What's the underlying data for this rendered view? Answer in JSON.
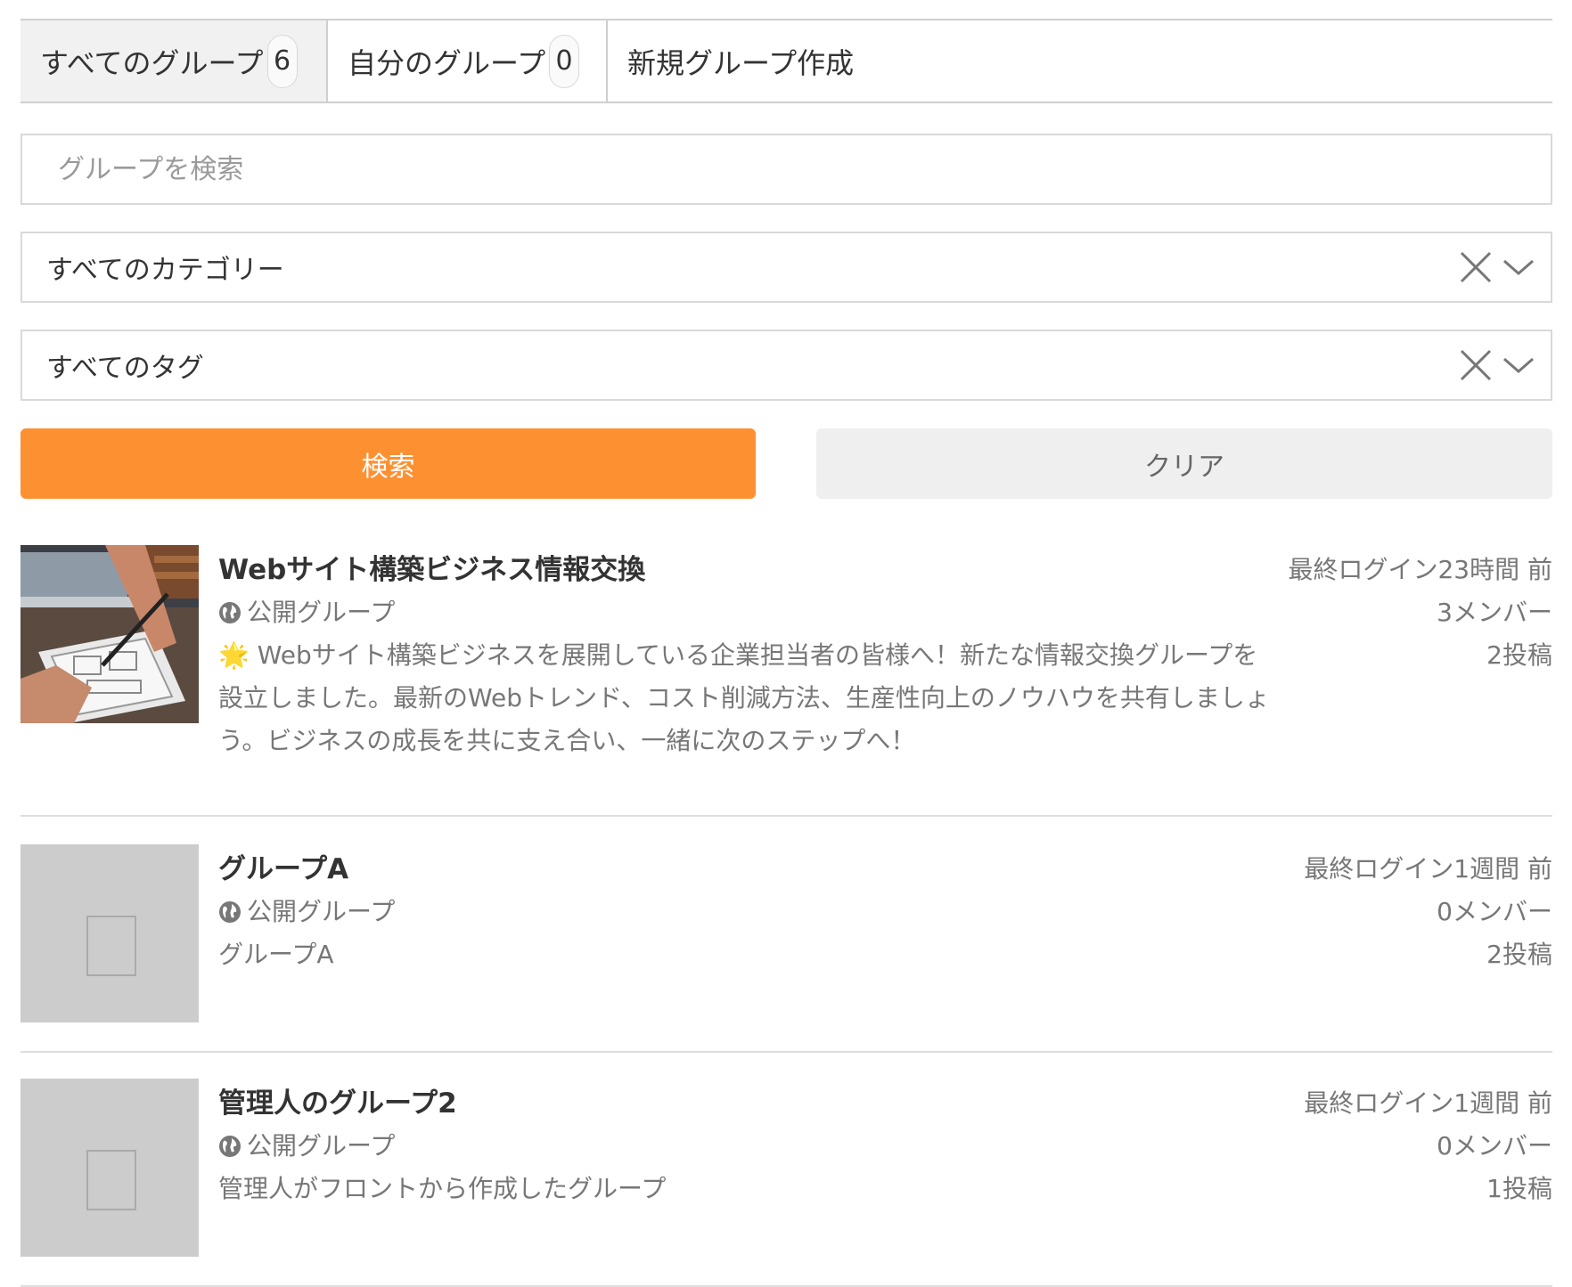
{
  "tabs": [
    {
      "label": "すべてのグループ",
      "count": "6"
    },
    {
      "label": "自分のグループ",
      "count": "0"
    },
    {
      "label": "新規グループ作成"
    }
  ],
  "search": {
    "placeholder": "グループを検索",
    "value": ""
  },
  "filters": {
    "category": {
      "selected": "すべてのカテゴリー"
    },
    "tag": {
      "selected": "すべてのタグ"
    }
  },
  "buttons": {
    "search_label": "検索",
    "clear_label": "クリア"
  },
  "colors": {
    "accent": "#fd9132",
    "clear_button": "#efefef",
    "placeholder_thumb": "#cccccc"
  },
  "groups": [
    {
      "name": "Webサイト構築ビジネス情報交換",
      "type": "公開グループ",
      "description": "🌟 Webサイト構築ビジネスを展開している企業担当者の皆様へ！新たな情報交換グループを設立しました。最新のWebトレンド、コスト削減方法、生産性向上のノウハウを共有しましょう。ビジネスの成長を共に支え合い、一緒に次のステップへ！",
      "last_login": "最終ログイン23時間 前",
      "members": "3メンバー",
      "posts": "2投稿",
      "thumbnail": "photo"
    },
    {
      "name": "グループA",
      "type": "公開グループ",
      "description": "グループA",
      "last_login": "最終ログイン1週間 前",
      "members": "0メンバー",
      "posts": "2投稿",
      "thumbnail": "placeholder"
    },
    {
      "name": "管理人のグループ2",
      "type": "公開グループ",
      "description": "管理人がフロントから作成したグループ",
      "last_login": "最終ログイン1週間 前",
      "members": "0メンバー",
      "posts": "1投稿",
      "thumbnail": "placeholder"
    }
  ]
}
